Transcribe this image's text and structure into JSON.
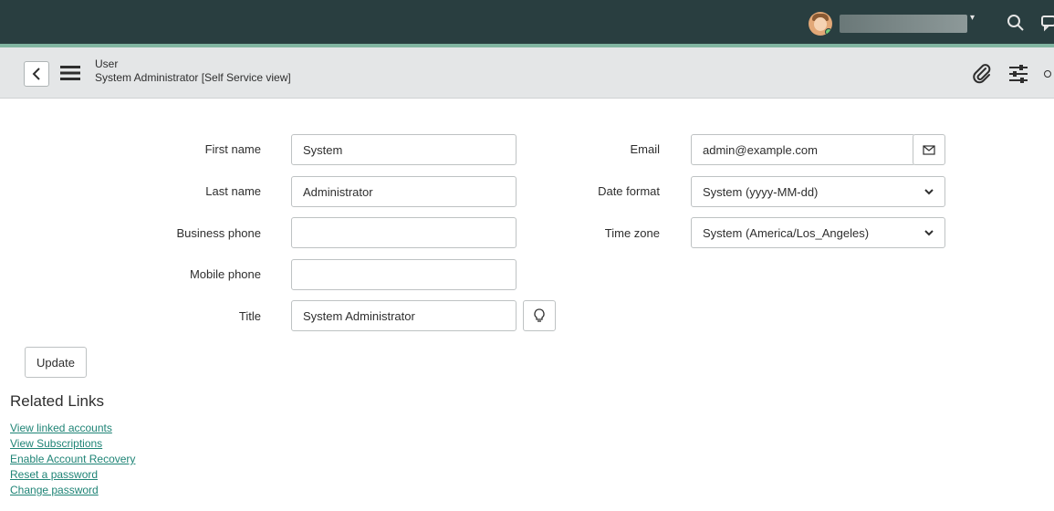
{
  "form": {
    "table_name": "User",
    "record_display": "System Administrator [Self Service view]"
  },
  "fields": {
    "first_name": {
      "label": "First name",
      "value": "System"
    },
    "last_name": {
      "label": "Last name",
      "value": "Administrator"
    },
    "business_phone": {
      "label": "Business phone",
      "value": ""
    },
    "mobile_phone": {
      "label": "Mobile phone",
      "value": ""
    },
    "title": {
      "label": "Title",
      "value": "System Administrator"
    },
    "email": {
      "label": "Email",
      "value": "admin@example.com"
    },
    "date_format": {
      "label": "Date format",
      "value": "System (yyyy-MM-dd)"
    },
    "time_zone": {
      "label": "Time zone",
      "value": "System (America/Los_Angeles)"
    }
  },
  "actions": {
    "update_label": "Update"
  },
  "related_links": {
    "heading": "Related Links",
    "items": [
      "View linked accounts",
      "View Subscriptions",
      "Enable Account Recovery",
      "Reset a password",
      "Change password"
    ]
  },
  "colors": {
    "banner": "#293e40",
    "banner_accent": "#81b5a1",
    "header_bg": "#e4e6e7",
    "link": "#1f8476"
  },
  "icons": [
    "avatar",
    "search-icon",
    "connect-icon",
    "back-icon",
    "menu-icon",
    "paperclip-icon",
    "sliders-icon",
    "more-icon",
    "envelope-icon",
    "lightbulb-icon",
    "chevron-down-icon"
  ]
}
